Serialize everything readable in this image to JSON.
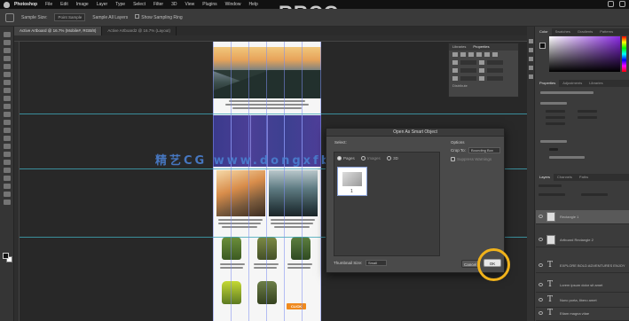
{
  "menubar": {
    "app": "Photoshop",
    "items": [
      "File",
      "Edit",
      "Image",
      "Layer",
      "Type",
      "Select",
      "Filter",
      "3D",
      "View",
      "Plugins",
      "Window",
      "Help"
    ]
  },
  "watermark": {
    "top": "RRCG",
    "middle": "精艺CG   www.dongxfb.cn"
  },
  "options": {
    "sample_label": "Sample Size:",
    "sample_value": "Point Sample",
    "sample_all": "Sample All Layers",
    "show_ring": "Show Sampling Ring"
  },
  "tabs": [
    "Active Artboard @ 16.7% (Mobile#, RGB/8)",
    "Active Artboard2 @ 16.7% (Layout)"
  ],
  "align_panel": {
    "tabs": [
      "Libraries",
      "Properties"
    ],
    "distribute_label": "Distribute"
  },
  "dialog": {
    "title": "Open As Smart Object",
    "select_label": "Select:",
    "radio_pages": "Pages",
    "radio_images": "Images",
    "radio_3d": "3D",
    "page_number": "1",
    "options_label": "Options",
    "crop_label": "Crop To:",
    "crop_value": "Bounding Box",
    "antialias_label": "Suppress Warnings",
    "thumb_label": "Thumbnail Size:",
    "thumb_value": "Small",
    "cancel": "Cancel",
    "ok": "OK"
  },
  "right_panel": {
    "top_tabs": [
      "Color",
      "Swatches",
      "Gradients",
      "Patterns"
    ],
    "props_tabs": [
      "Properties",
      "Adjustments",
      "Libraries"
    ],
    "layers_tabs": [
      "Layers",
      "Channels",
      "Paths"
    ],
    "layers": [
      {
        "type": "image",
        "name": "Rectangle 1"
      },
      {
        "type": "image",
        "name": "Artboard Rectangle 2"
      },
      {
        "type": "text",
        "name": "EXPLORE BOLD ADVENTURES ENJOY"
      },
      {
        "type": "text",
        "name": "Lorem ipsum dolor sit amet"
      },
      {
        "type": "text",
        "name": "Nunc porta, libero amet"
      },
      {
        "type": "text",
        "name": "Etiam magna vitae"
      }
    ]
  },
  "canvas": {
    "cta_button": "CLICK"
  }
}
